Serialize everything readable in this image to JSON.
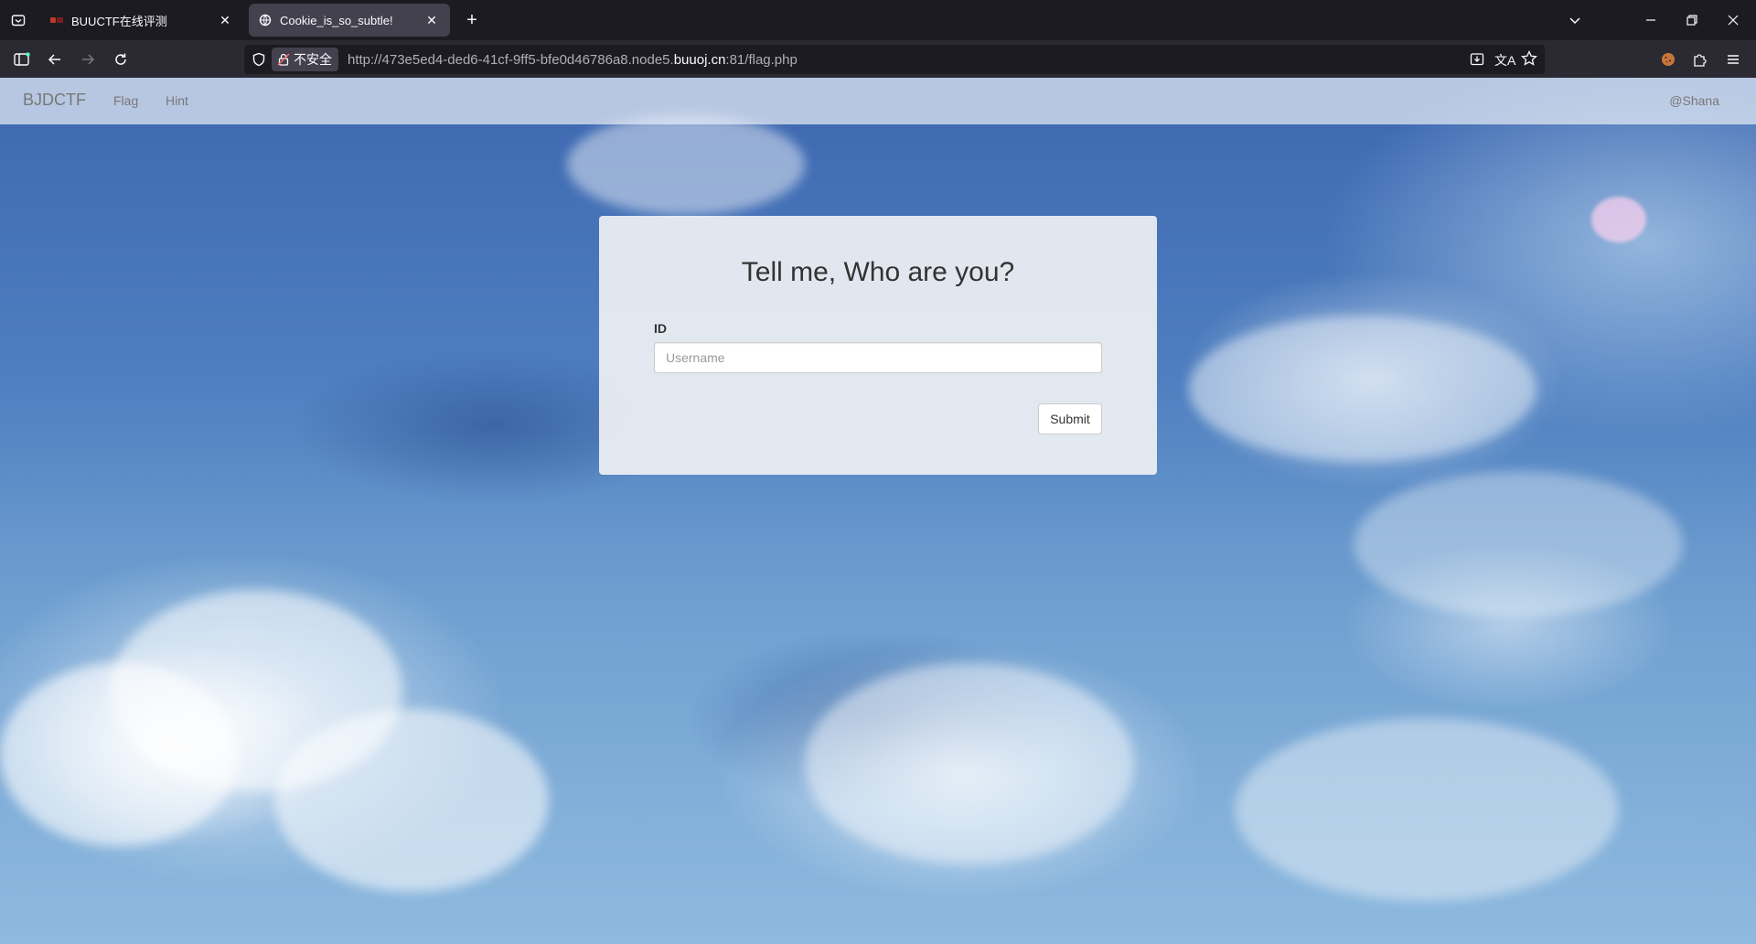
{
  "browser": {
    "tabs": [
      {
        "title": "BUUCTF在线评测",
        "active": false
      },
      {
        "title": "Cookie_is_so_subtle!",
        "active": true
      }
    ],
    "urlbar": {
      "security_label": "不安全",
      "url_prefix": "http://473e5ed4-ded6-41cf-9ff5-bfe0d46786a8.node5.",
      "url_host": "buuoj.cn",
      "url_suffix": ":81/flag.php"
    },
    "accent_color": "#42414d"
  },
  "site": {
    "brand": "BJDCTF",
    "nav_links": [
      "Flag",
      "Hint"
    ],
    "nav_right": "@Shana"
  },
  "form": {
    "title": "Tell me, Who are you?",
    "id_label": "ID",
    "username_placeholder": "Username",
    "username_value": "",
    "submit_label": "Submit"
  }
}
